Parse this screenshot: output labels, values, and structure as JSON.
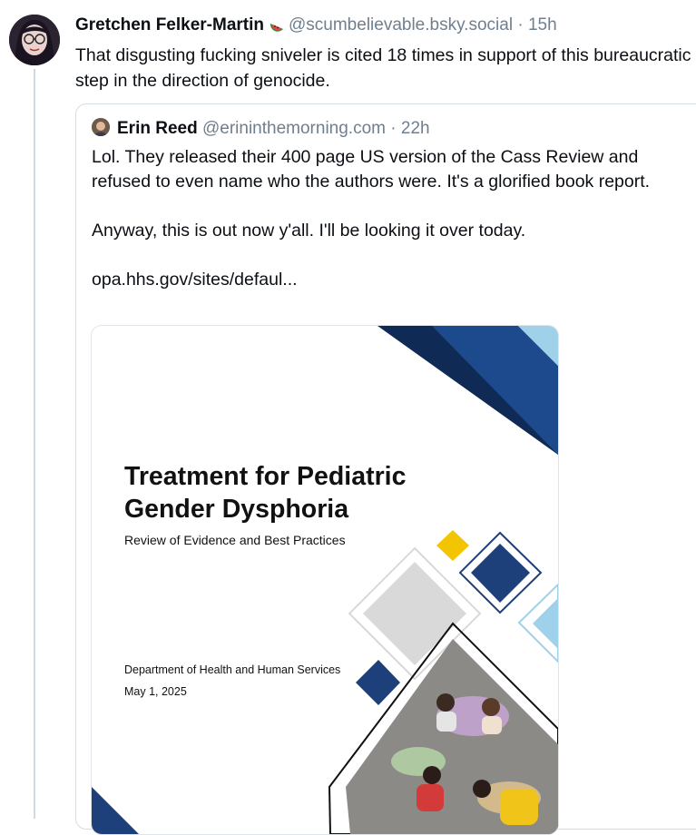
{
  "post": {
    "author_name": "Gretchen Felker-Martin",
    "author_emoji": "watermelon-icon",
    "handle": "@scumbelievable.bsky.social",
    "separator": "·",
    "time": "15h",
    "text": "That disgusting fucking sniveler is cited 18 times in support of this bureaucratic step in the direction of genocide."
  },
  "quote": {
    "author_name": "Erin Reed",
    "handle": "@erininthemorning.com",
    "separator": "·",
    "time": "22h",
    "paragraph1": "Lol. They released their 400 page US version of the Cass Review and refused to even name who the authors were. It's a glorified book report.",
    "paragraph2": "Anyway, this is out now y'all. I'll be looking it over today.",
    "link": "opa.hhs.gov/sites/defaul...",
    "document": {
      "title_line1": "Treatment for Pediatric",
      "title_line2": "Gender Dysphoria",
      "subtitle": "Review of Evidence and Best Practices",
      "department": "Department of Health and Human Services",
      "date": "May 1, 2025"
    }
  },
  "colors": {
    "thread_line": "#cfd9e2",
    "handle_gray": "#6f7f8e",
    "doc_navy": "#1d3f7a",
    "doc_dark_navy": "#0f2a55",
    "doc_light_blue": "#9fd1ea",
    "doc_yellow": "#f2c500",
    "doc_gray": "#d9d9d9"
  }
}
